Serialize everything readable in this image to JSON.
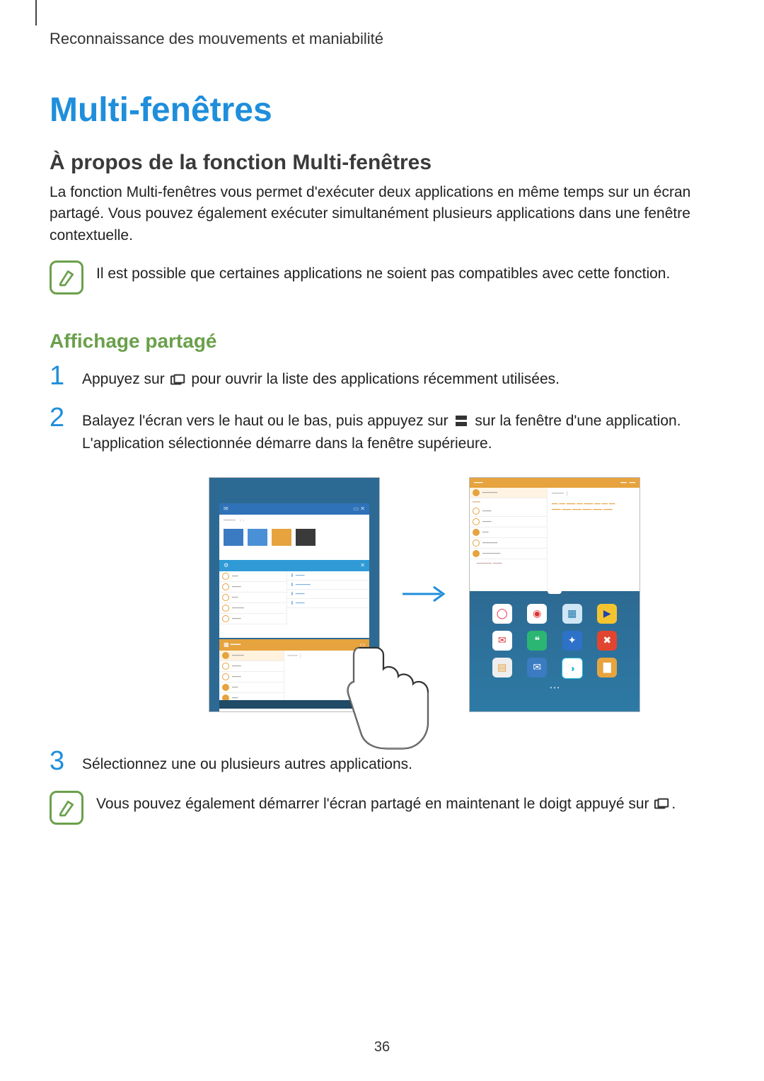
{
  "breadcrumb": "Reconnaissance des mouvements et maniabilité",
  "title": "Multi-fenêtres",
  "section1": {
    "heading": "À propos de la fonction Multi-fenêtres",
    "body": "La fonction Multi-fenêtres vous permet d'exécuter deux applications en même temps sur un écran partagé. Vous pouvez également exécuter simultanément plusieurs applications dans une fenêtre contextuelle.",
    "note": "Il est possible que certaines applications ne soient pas compatibles avec cette fonction."
  },
  "section2": {
    "heading": "Affichage partagé",
    "steps": {
      "s1_num": "1",
      "s1_a": "Appuyez sur ",
      "s1_b": " pour ouvrir la liste des applications récemment utilisées.",
      "s2_num": "2",
      "s2_a": "Balayez l'écran vers le haut ou le bas, puis appuyez sur ",
      "s2_b": " sur la fenêtre d'une application. L'application sélectionnée démarre dans la fenêtre supérieure.",
      "s3_num": "3",
      "s3": "Sélectionnez une ou plusieurs autres applications."
    },
    "note2_a": "Vous pouvez également démarrer l'écran partagé en maintenant le doigt appuyé sur ",
    "note2_b": "."
  },
  "page_number": "36"
}
